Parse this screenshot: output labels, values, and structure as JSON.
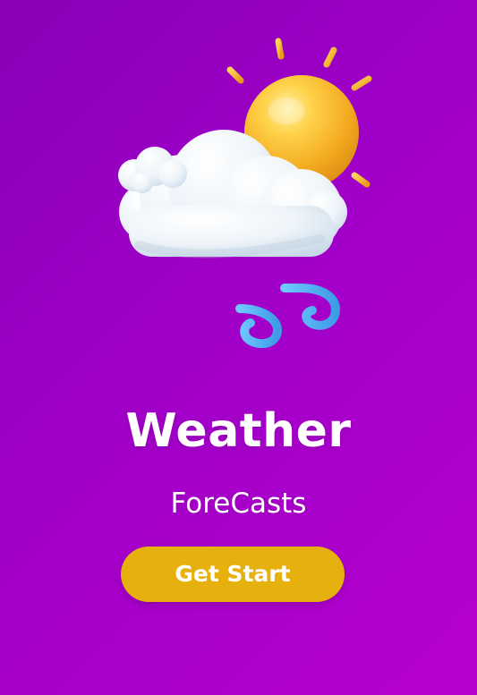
{
  "theme": {
    "background_start": "#8a00b8",
    "background_end": "#b800d0",
    "accent": "#e6b00f",
    "text": "#ffffff"
  },
  "hero": {
    "icons": [
      "sun-icon",
      "cloud-icon",
      "wind-icon"
    ]
  },
  "main": {
    "title": "Weather",
    "subtitle": "ForeCasts"
  },
  "cta": {
    "label": "Get Start"
  }
}
